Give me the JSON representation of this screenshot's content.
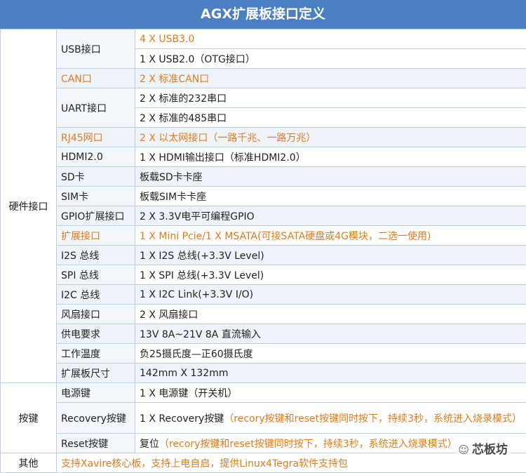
{
  "title": "AGX扩展板接口定义",
  "hardware": {
    "category": "硬件接口",
    "rows": [
      {
        "name": "USB接口",
        "values": [
          "4 X USB3.0",
          "1 X USB2.0（OTG接口）"
        ]
      },
      {
        "name": "CAN口",
        "values": [
          "2 X 标准CAN口"
        ]
      },
      {
        "name": "UART接口",
        "values": [
          "2 X 标准的232串口",
          "2 X 标准的485串口"
        ]
      },
      {
        "name": "RJ45网口",
        "values": [
          "2 X 以太网接口（一路千兆、一路万兆）"
        ]
      },
      {
        "name": "HDMI2.0",
        "values": [
          "1 X HDMI输出接口（标准HDMI2.0）"
        ]
      },
      {
        "name": "SD卡",
        "values": [
          "板载SD卡卡座"
        ]
      },
      {
        "name": "SIM卡",
        "values": [
          "板载SIM卡卡座"
        ]
      },
      {
        "name": "GPIO扩展接口",
        "values": [
          "2 X 3.3V电平可编程GPIO"
        ]
      },
      {
        "name": "扩展接口",
        "values": [
          "1 X Mini Pcie/1 X  MSATA(可接SATA硬盘或4G模块，二选一使用)"
        ]
      },
      {
        "name": "I2S 总线",
        "values": [
          "1 X I2S 总线(+3.3V Level)"
        ]
      },
      {
        "name": "SPI 总线",
        "values": [
          "1 X SPI 总线(+3.3V Level)"
        ]
      },
      {
        "name": "I2C 总线",
        "values": [
          "1 X I2C Link(+3.3V I/O)"
        ]
      },
      {
        "name": "风扇接口",
        "values": [
          "2 X 风扇接口"
        ]
      },
      {
        "name": "供电要求",
        "values": [
          "13V 8A~21V 8A 直流输入"
        ]
      },
      {
        "name": "工作温度",
        "values": [
          "负25摄氏度—正60摄氏度"
        ]
      },
      {
        "name": "扩展板尺寸",
        "values": [
          "142mm X 132mm"
        ]
      }
    ]
  },
  "keys": {
    "category": "按键",
    "power": {
      "name": "电源键",
      "value": "1 X 电源键（开关机）"
    },
    "recovery": {
      "name": "Recovery按键",
      "value_black": "1 X Recovery按键",
      "value_orange": "（recory按键和reset按键同时按下，持续3秒，系统进入烧录模式）"
    },
    "reset": {
      "name": "Reset按键",
      "value_black": "复位",
      "value_orange": "（recory按键和reset按键同时按下，持续3秒，系统进入烧录模式）"
    }
  },
  "other": {
    "category": "其他",
    "value": "支持Xavire核心板，支持上电自启，提供Linux4Tegra软件支持包"
  },
  "watermark": "芯板坊",
  "colors": {
    "header": "#4a7fc1",
    "accent": "#e07b1c",
    "border": "#b9cde6"
  }
}
